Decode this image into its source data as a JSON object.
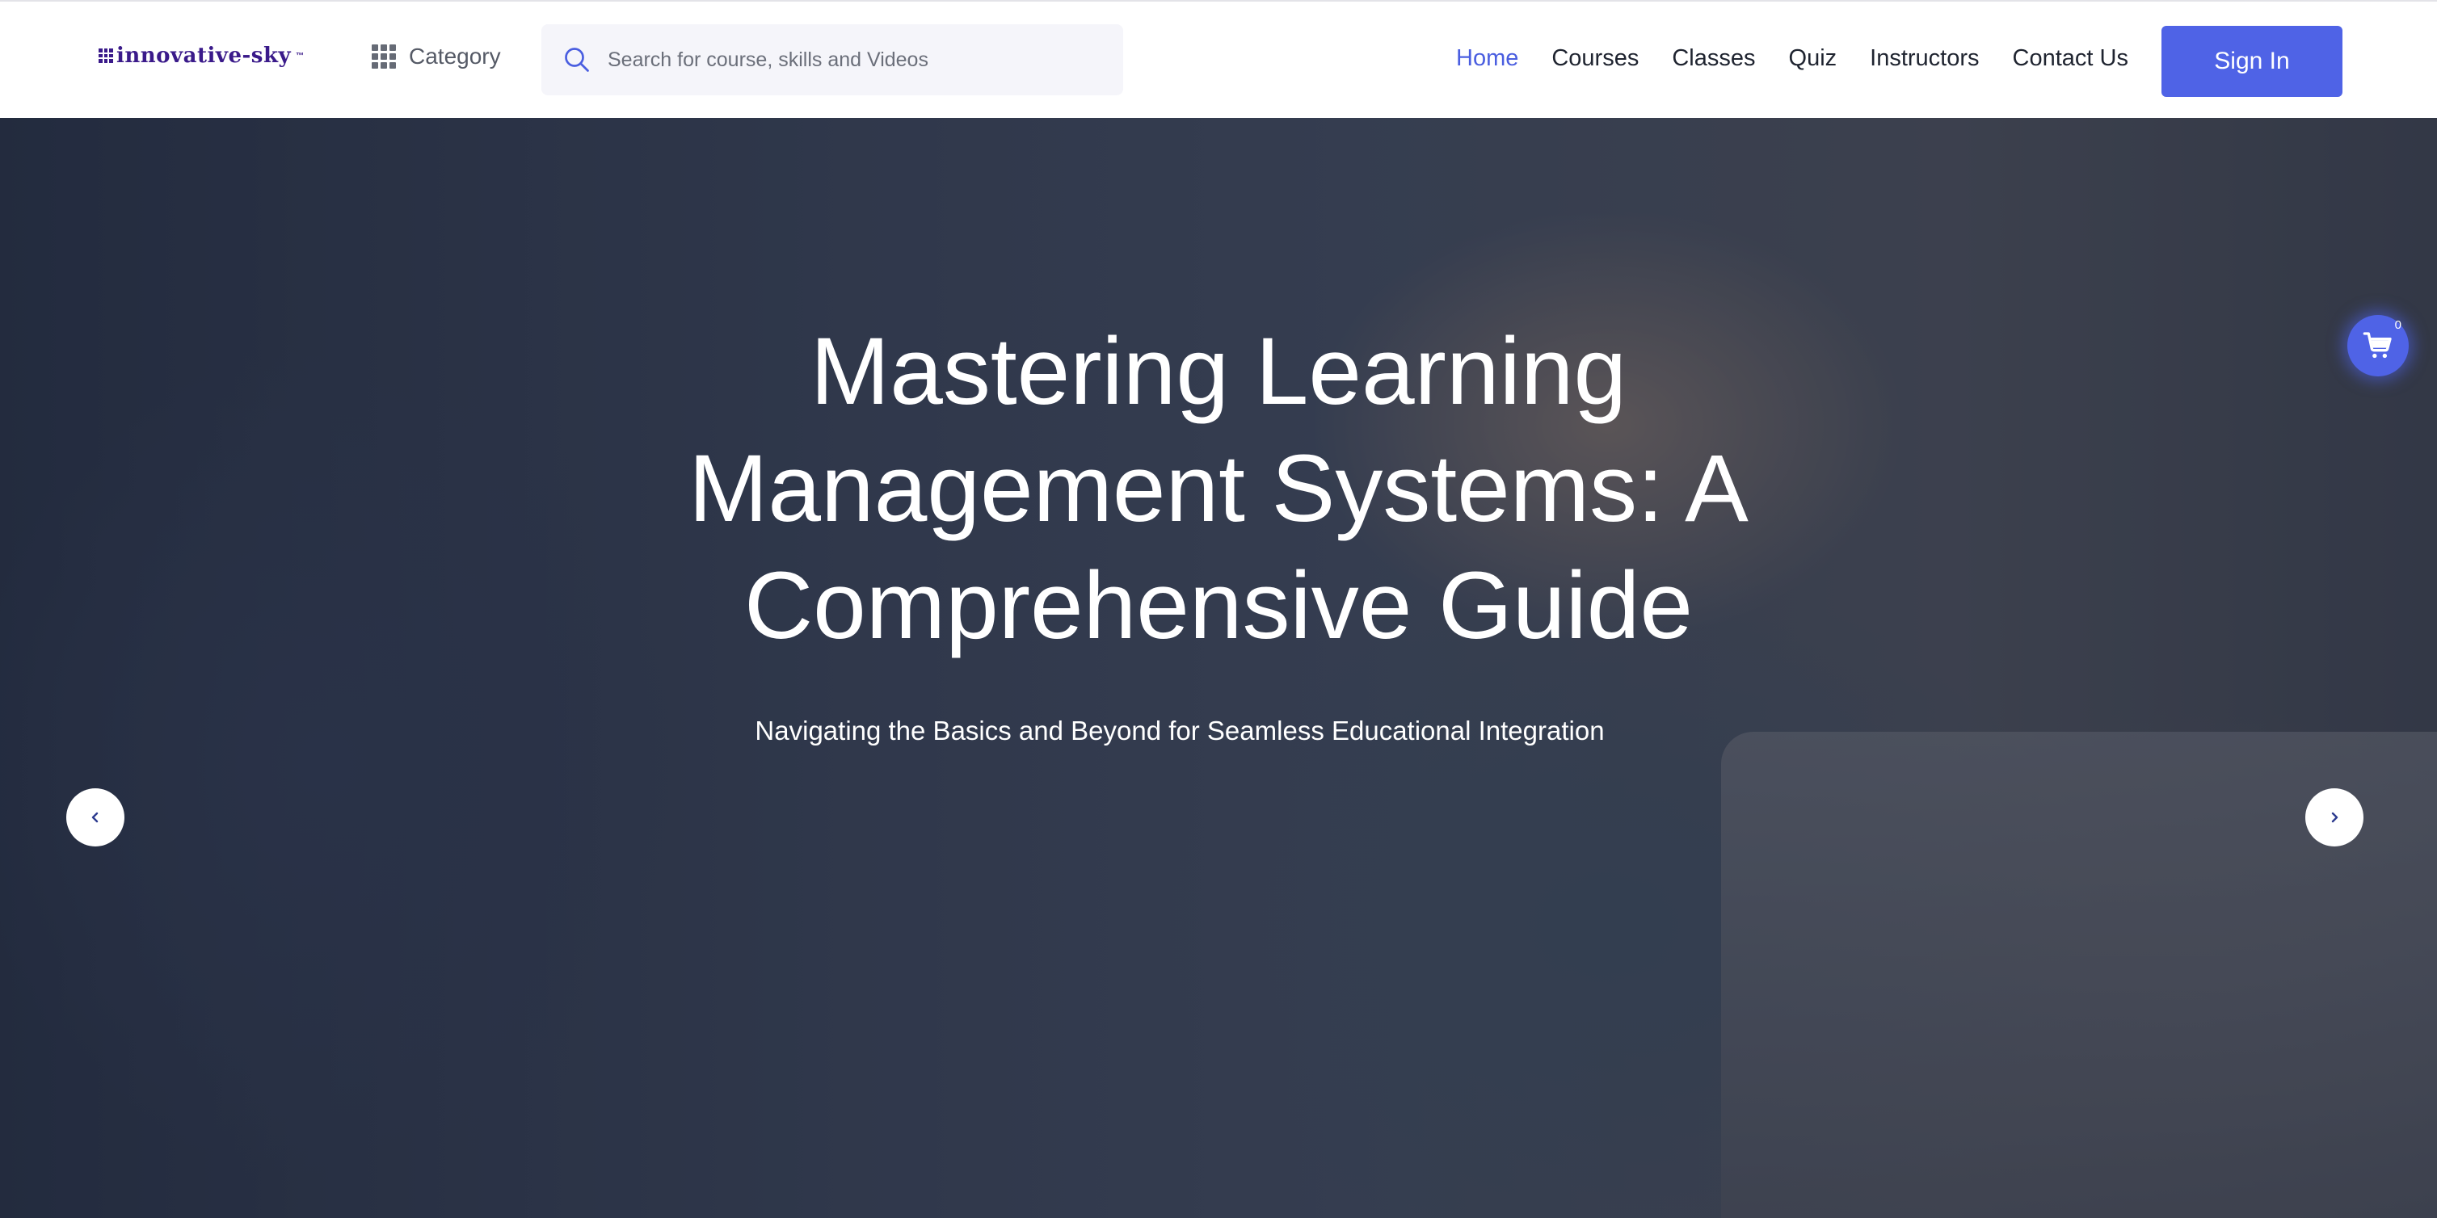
{
  "colors": {
    "accent": "#4f63e6",
    "nav_active": "#4a5ee0",
    "logo": "#3a1a8a"
  },
  "header": {
    "logo_text": "innovative-sky",
    "logo_tm": "™",
    "category_label": "Category",
    "category_icon": "grid-icon",
    "search": {
      "placeholder": "Search for course, skills and Videos",
      "value": "",
      "icon": "search-icon"
    },
    "nav": [
      {
        "label": "Home",
        "active": true
      },
      {
        "label": "Courses",
        "active": false
      },
      {
        "label": "Classes",
        "active": false
      },
      {
        "label": "Quiz",
        "active": false
      },
      {
        "label": "Instructors",
        "active": false
      },
      {
        "label": "Contact Us",
        "active": false
      }
    ],
    "signin_label": "Sign In"
  },
  "hero": {
    "title": "Mastering Learning Management Systems: A Comprehensive Guide",
    "subtitle": "Navigating the Basics and Beyond for Seamless Educational Integration",
    "prev_icon": "chevron-left-icon",
    "next_icon": "chevron-right-icon"
  },
  "cart": {
    "count": "0",
    "icon": "cart-icon"
  }
}
